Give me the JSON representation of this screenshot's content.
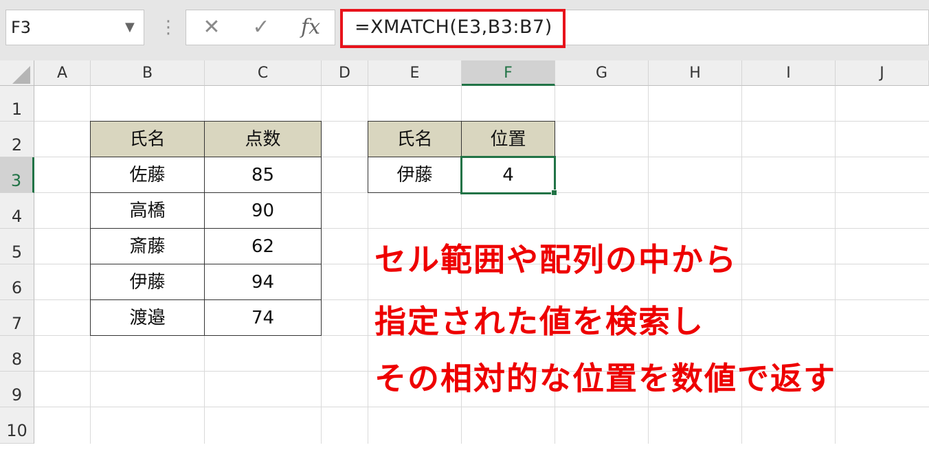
{
  "formula_bar": {
    "name_box": "F3",
    "name_box_arrow": "▼",
    "separator": "⋮",
    "cancel": "✕",
    "enter": "✓",
    "fx": "fx",
    "formula": "=XMATCH(E3,B3:B7)",
    "highlight_color": "#e8131b"
  },
  "columns": [
    "A",
    "B",
    "C",
    "D",
    "E",
    "F",
    "G",
    "H",
    "I",
    "J"
  ],
  "rows": [
    "1",
    "2",
    "3",
    "4",
    "5",
    "6",
    "7",
    "8",
    "9",
    "10"
  ],
  "selected": {
    "column": "F",
    "row": "3"
  },
  "table1": {
    "headers": [
      "氏名",
      "点数"
    ],
    "rows": [
      [
        "佐藤",
        "85"
      ],
      [
        "高橋",
        "90"
      ],
      [
        "斎藤",
        "62"
      ],
      [
        "伊藤",
        "94"
      ],
      [
        "渡邉",
        "74"
      ]
    ]
  },
  "table2": {
    "headers": [
      "氏名",
      "位置"
    ],
    "row": [
      "伊藤",
      "4"
    ]
  },
  "caption": [
    "セル範囲や配列の中から",
    "指定された値を検索し",
    "その相対的な位置を数値で返す"
  ],
  "colors": {
    "accent": "#217346",
    "header_fill": "#d9d6bf",
    "caption": "#ee0000"
  }
}
